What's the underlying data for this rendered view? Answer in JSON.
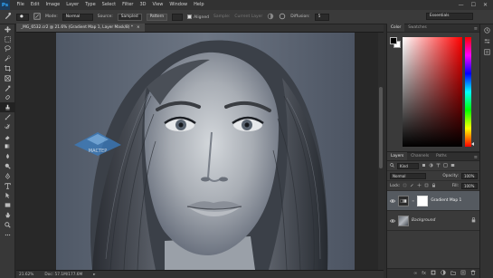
{
  "app": {
    "logo": "Ps",
    "menu": [
      "File",
      "Edit",
      "Image",
      "Layer",
      "Type",
      "Select",
      "Filter",
      "3D",
      "View",
      "Window",
      "Help"
    ],
    "window_controls": [
      "—",
      "☐",
      "✕"
    ]
  },
  "options_bar": {
    "mode_label": "Mode:",
    "mode_value": "Normal",
    "source_label": "Source:",
    "sampled_label": "Sampled",
    "pattern_label": "Pattern",
    "aligned_label": "Aligned",
    "sample_label": "Sample:",
    "sample_value": "Current Layer",
    "diffusion_label": "Diffusion:",
    "diffusion_value": "5",
    "workspace": "Essentials"
  },
  "document": {
    "tab_title": "_MG_6532.cr2 @ 21.6% (Gradient Map 1, Layer Mask/8) *",
    "tab_close": "×",
    "zoom": "21.62%",
    "doc_size": "Doc: 57.1M/177.6M"
  },
  "color_panel": {
    "tabs": [
      "Color",
      "Swatches"
    ],
    "active_tab": "Color",
    "foreground": "#000000",
    "background": "#ffffff"
  },
  "layers_panel": {
    "tabs": [
      "Layers",
      "Channels",
      "Paths"
    ],
    "active_tab": "Layers",
    "filter_kind": "Kind",
    "blend_mode": "Normal",
    "opacity_label": "Opacity:",
    "opacity_value": "100%",
    "lock_label": "Lock:",
    "fill_label": "Fill:",
    "fill_value": "100%",
    "layers": [
      {
        "name": "Gradient Map 1",
        "visible": true,
        "selected": true,
        "type": "adjustment"
      },
      {
        "name": "Background",
        "visible": true,
        "selected": false,
        "type": "image",
        "locked": true
      }
    ]
  },
  "watermark": {
    "text": "МАСТЕР"
  },
  "colors": {
    "accent": "#31a8ff",
    "selection": "#555a60"
  }
}
